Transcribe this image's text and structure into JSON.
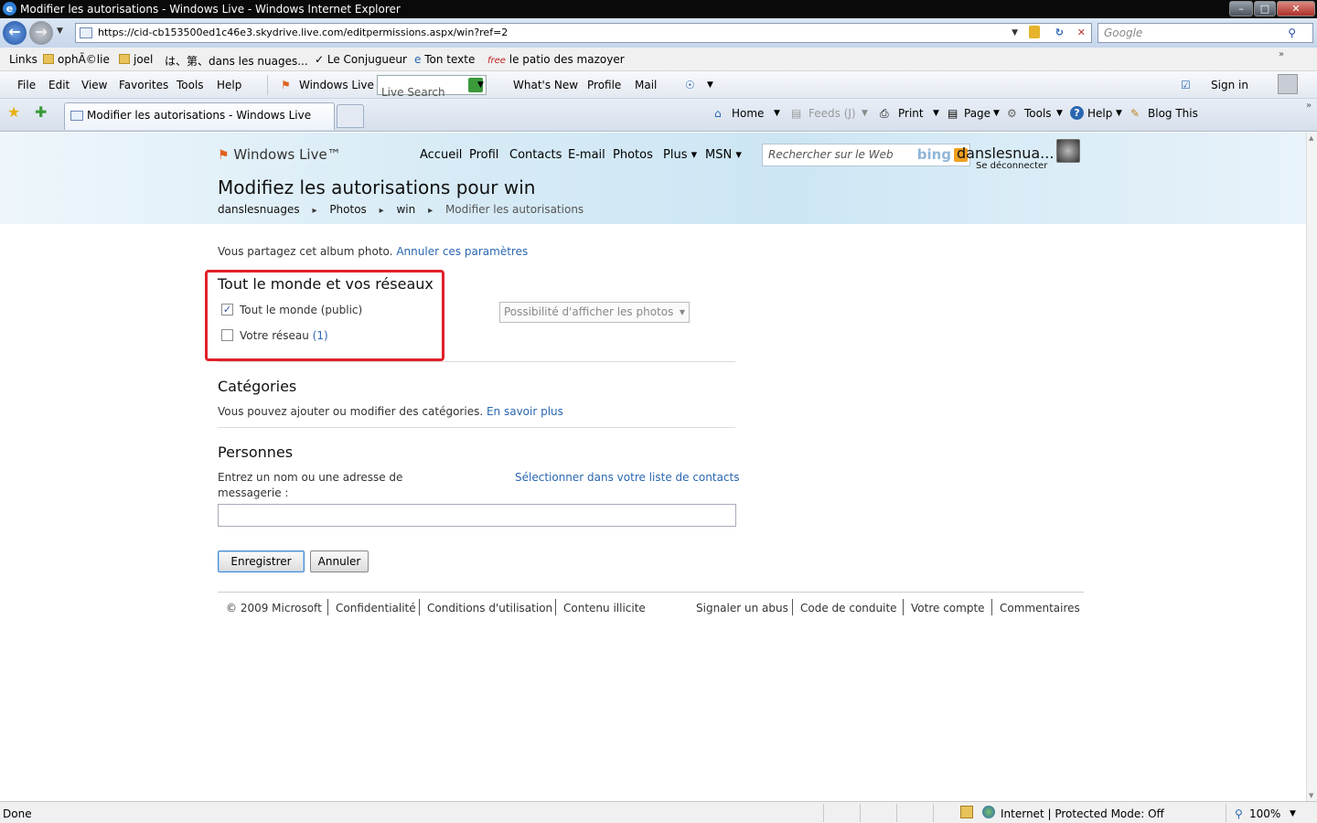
{
  "window": {
    "title": "Modifier les autorisations - Windows Live - Windows Internet Explorer",
    "min": "–",
    "max": "□",
    "close": "✕"
  },
  "addressbar": {
    "url": "https://cid-cb153500ed1c46e3.skydrive.live.com/editpermissions.aspx/win?ref=2",
    "search_placeholder": "Google"
  },
  "links_bar": {
    "label": "Links",
    "items": [
      "ophÃ©lie",
      "joel",
      "は、第、dans les nuages...",
      "Le Conjugueur",
      "Ton texte",
      "le patio des mazoyer"
    ]
  },
  "menu": {
    "items": [
      "File",
      "Edit",
      "View",
      "Favorites",
      "Tools",
      "Help"
    ],
    "windows_live": "Windows Live",
    "live_search": "Live Search",
    "whats_new": "What's New",
    "profile": "Profile",
    "mail": "Mail",
    "sign_in": "Sign in"
  },
  "tabs": {
    "active_title": "Modifier les autorisations - Windows Live",
    "commands": [
      "Home",
      "Feeds (J)",
      "Print",
      "Page",
      "Tools",
      "Help",
      "Blog This"
    ]
  },
  "wl_header": {
    "logo": "Windows Live™",
    "nav": [
      "Accueil",
      "Profil",
      "Contacts",
      "E-mail",
      "Photos",
      "Plus ▾",
      "MSN ▾"
    ],
    "search_placeholder": "Rechercher sur le Web",
    "bing": "bing",
    "username": "danslesnua...",
    "signout": "Se déconnecter"
  },
  "page": {
    "title": "Modifiez les autorisations pour win",
    "breadcrumb": [
      "danslesnuages",
      "Photos",
      "win",
      "Modifier les autorisations"
    ],
    "breadcrumb_sep": "▸",
    "sharing_text": "Vous partagez cet album photo.",
    "sharing_link": "Annuler ces paramètres",
    "section1": {
      "heading": "Tout le monde et vos réseaux",
      "options": [
        {
          "label": "Tout le monde (public)",
          "checked": true
        },
        {
          "label": "Votre réseau",
          "count": "(1)",
          "checked": false
        }
      ],
      "permission_select": "Possibilité d'afficher les photos"
    },
    "section2": {
      "heading": "Catégories",
      "text": "Vous pouvez ajouter ou modifier des catégories.",
      "link": "En savoir plus"
    },
    "section3": {
      "heading": "Personnes",
      "label": "Entrez un nom ou une adresse de messagerie :",
      "contacts_link": "Sélectionner dans votre liste de contacts",
      "input_value": ""
    },
    "save_button": "Enregistrer",
    "cancel_button": "Annuler"
  },
  "footer": {
    "left": [
      "© 2009 Microsoft",
      "Confidentialité",
      "Conditions d'utilisation",
      "Contenu illicite"
    ],
    "right": [
      "Signaler un abus",
      "Code de conduite",
      "Votre compte",
      "Commentaires"
    ]
  },
  "statusbar": {
    "status": "Done",
    "zone": "Internet | Protected Mode: Off",
    "zoom": "100%"
  },
  "colors": {
    "link": "#2a67b0",
    "highlight_box": "#e0202a",
    "titlebar": "#0a0a0a"
  }
}
